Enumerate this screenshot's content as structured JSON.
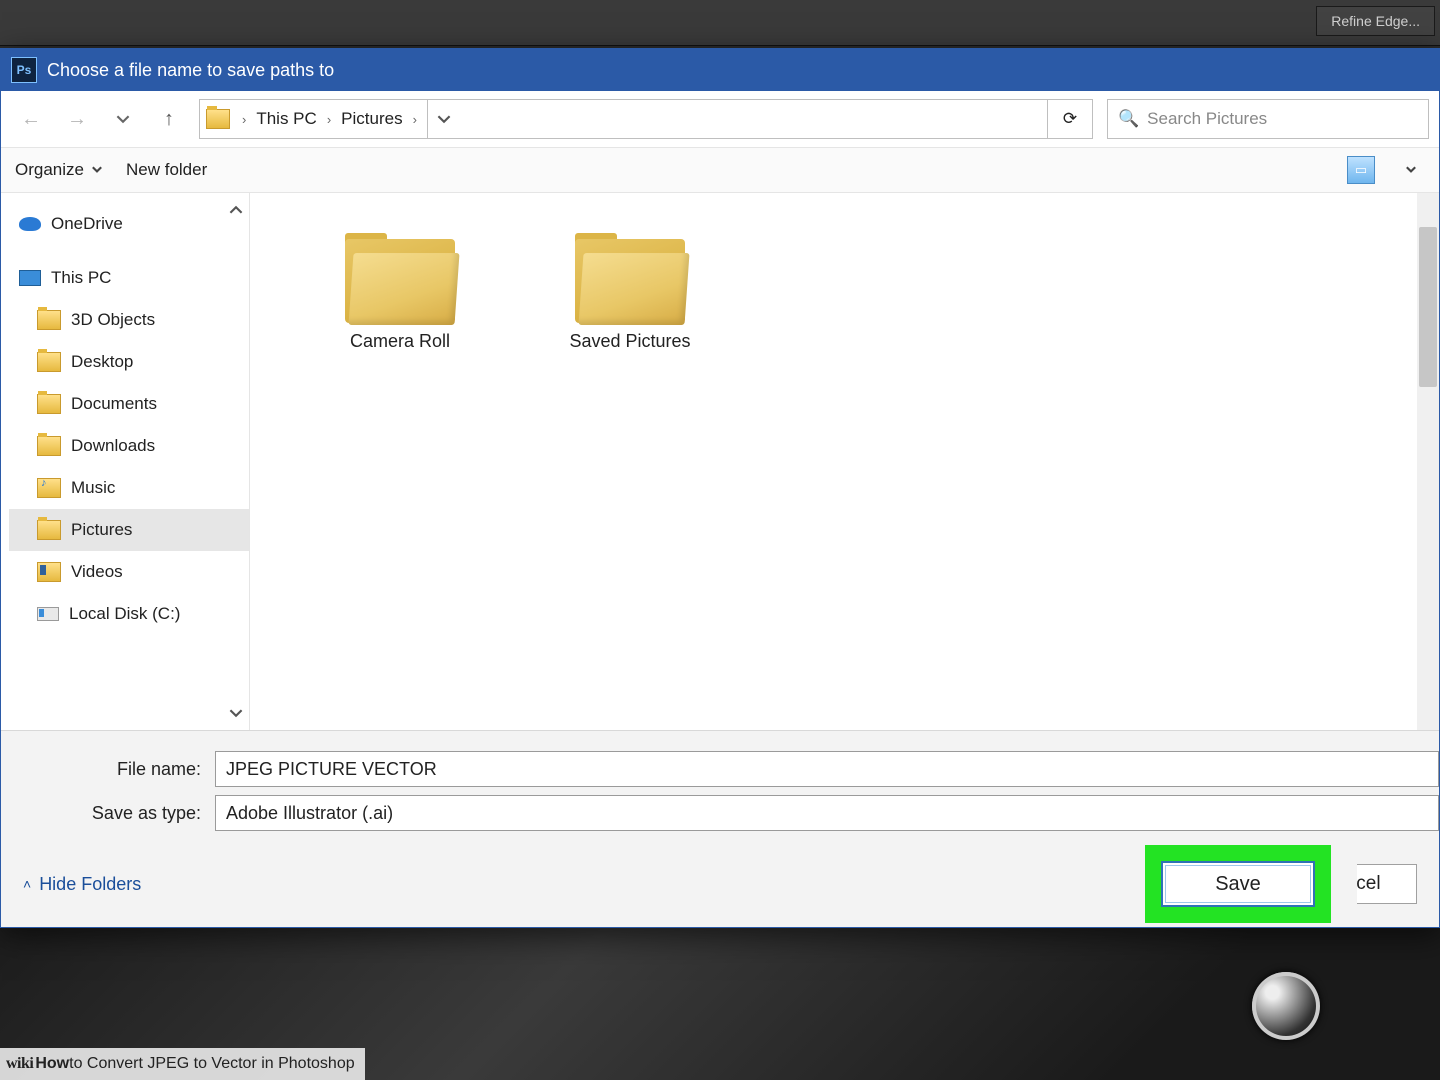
{
  "watermark": {
    "prefix": "wiki",
    "bold": "How",
    "rest": " to Convert JPEG to Vector in Photoshop"
  },
  "ps_panel": {
    "label": "Refine Edge..."
  },
  "dialog": {
    "title": "Choose a file name to save paths to",
    "icon_text": "Ps",
    "breadcrumb": {
      "items": [
        "This PC",
        "Pictures"
      ]
    },
    "search": {
      "placeholder": "Search Pictures"
    },
    "toolbar": {
      "organize": "Organize",
      "new_folder": "New folder"
    },
    "sidebar": [
      {
        "label": "OneDrive",
        "level": 0,
        "icon": "cloud"
      },
      {
        "label": "This PC",
        "level": 0,
        "icon": "monitor"
      },
      {
        "label": "3D Objects",
        "level": 1,
        "icon": "folder"
      },
      {
        "label": "Desktop",
        "level": 1,
        "icon": "folder"
      },
      {
        "label": "Documents",
        "level": 1,
        "icon": "folder"
      },
      {
        "label": "Downloads",
        "level": 1,
        "icon": "folder"
      },
      {
        "label": "Music",
        "level": 1,
        "icon": "music"
      },
      {
        "label": "Pictures",
        "level": 1,
        "icon": "folder",
        "selected": true
      },
      {
        "label": "Videos",
        "level": 1,
        "icon": "video"
      },
      {
        "label": "Local Disk (C:)",
        "level": 1,
        "icon": "drive"
      }
    ],
    "folders": [
      {
        "label": "Camera Roll"
      },
      {
        "label": "Saved Pictures"
      }
    ],
    "file_name": {
      "label": "File name:",
      "value": "JPEG PICTURE VECTOR"
    },
    "save_as_type": {
      "label": "Save as type:",
      "value": "Adobe Illustrator (.ai)"
    },
    "hide_folders": "Hide Folders",
    "buttons": {
      "save": "Save",
      "cancel": "Cancel"
    }
  }
}
